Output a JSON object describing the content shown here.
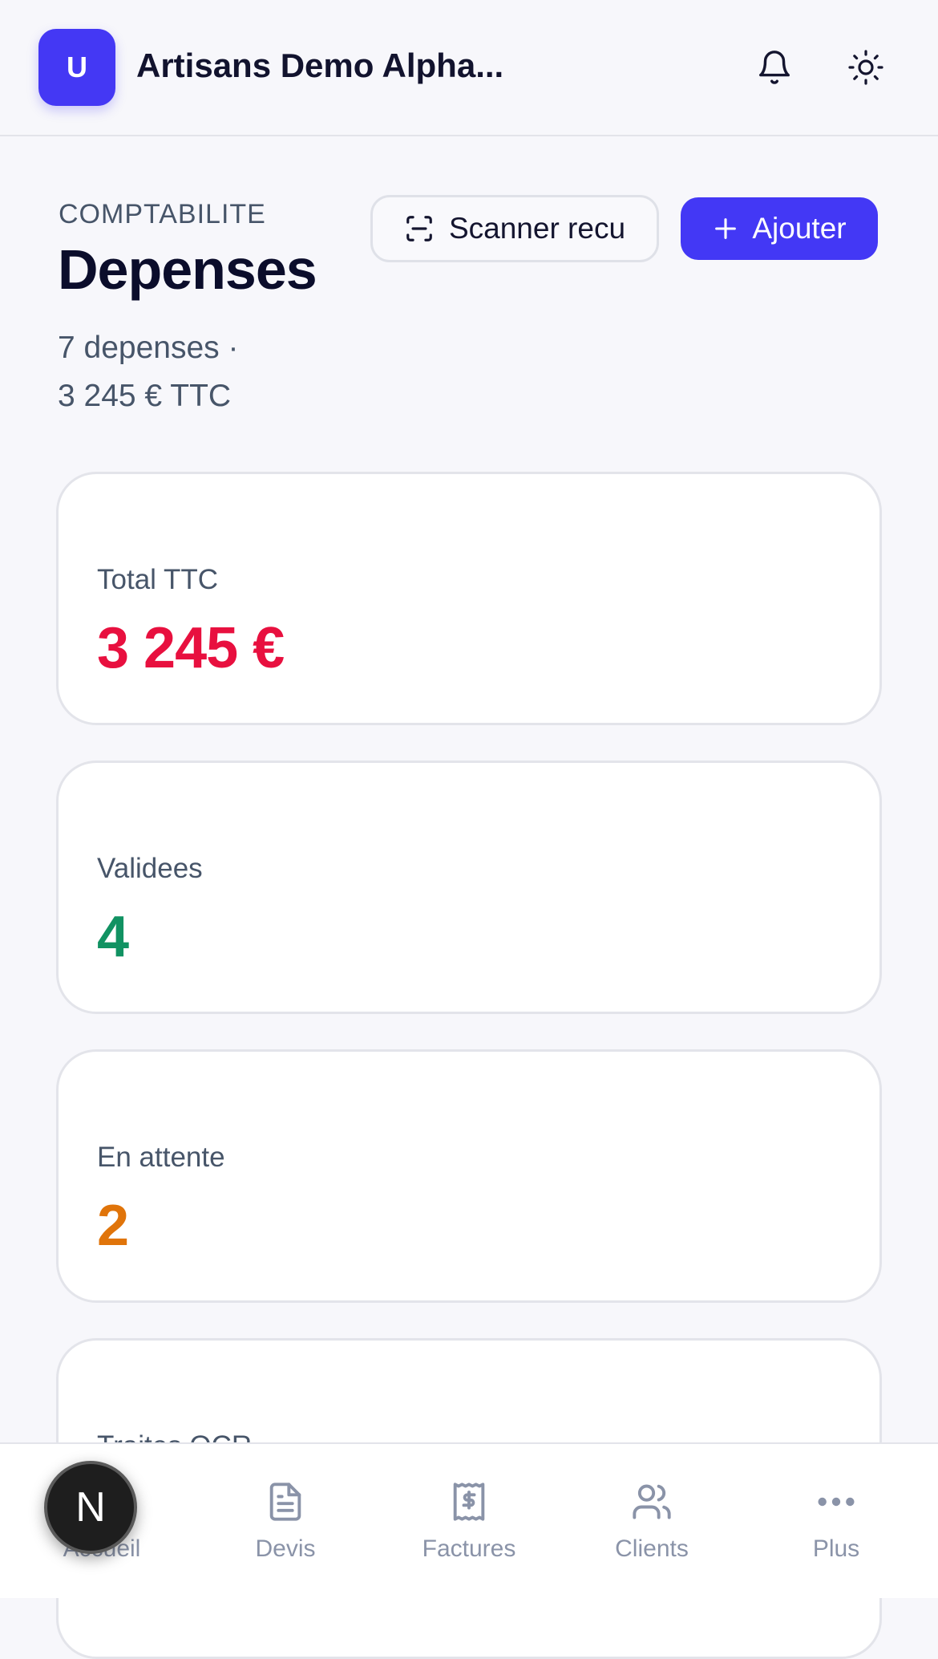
{
  "header": {
    "avatar_letter": "U",
    "org_name": "Artisans Demo Alpha..."
  },
  "page": {
    "eyebrow": "COMPTABILITE",
    "title": "Depenses",
    "summary_line1": "7 depenses ·",
    "summary_line2": "3 245 € TTC"
  },
  "actions": {
    "scan_label": "Scanner recu",
    "add_label": "Ajouter"
  },
  "stats": [
    {
      "label": "Total TTC",
      "value": "3 245 €",
      "color": "#e8103f"
    },
    {
      "label": "Validees",
      "value": "4",
      "color": "#119262"
    },
    {
      "label": "En attente",
      "value": "2",
      "color": "#e0740a"
    },
    {
      "label": "Traites OCR",
      "value": "",
      "color": "#475569"
    }
  ],
  "tabs": [
    {
      "label": "Accueil",
      "icon": "home-icon"
    },
    {
      "label": "Devis",
      "icon": "document-icon"
    },
    {
      "label": "Factures",
      "icon": "receipt-icon"
    },
    {
      "label": "Clients",
      "icon": "users-icon"
    },
    {
      "label": "Plus",
      "icon": "more-icon"
    }
  ],
  "dev_badge": "N"
}
